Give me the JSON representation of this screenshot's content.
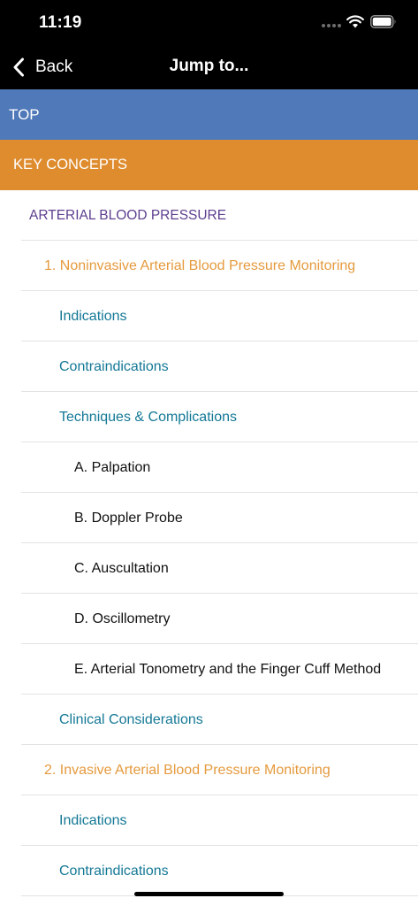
{
  "status": {
    "time": "11:19"
  },
  "nav": {
    "back_label": "Back",
    "title": "Jump to..."
  },
  "sections": {
    "top": "TOP",
    "key_concepts": "KEY CONCEPTS"
  },
  "toc": [
    {
      "label": "ARTERIAL BLOOD PRESSURE",
      "level": 0
    },
    {
      "label": "1. Noninvasive Arterial Blood Pressure Monitoring",
      "level": 1
    },
    {
      "label": "Indications",
      "level": 2
    },
    {
      "label": "Contraindications",
      "level": 2
    },
    {
      "label": "Techniques & Complications",
      "level": 2
    },
    {
      "label": "A. Palpation",
      "level": 3
    },
    {
      "label": "B. Doppler Probe",
      "level": 3
    },
    {
      "label": "C. Auscultation",
      "level": 3
    },
    {
      "label": "D. Oscillometry",
      "level": 3
    },
    {
      "label": "E. Arterial Tonometry and the Finger Cuff Method",
      "level": 3
    },
    {
      "label": "Clinical Considerations",
      "level": 2
    },
    {
      "label": "2. Invasive Arterial Blood Pressure Monitoring",
      "level": 1
    },
    {
      "label": "Indications",
      "level": 2
    },
    {
      "label": "Contraindications",
      "level": 2
    }
  ],
  "colors": {
    "top_bar": "#5079b9",
    "key_concepts_bar": "#de8c2e",
    "level_0": "#5d3f8f",
    "level_1": "#e59a3e",
    "level_2": "#147896",
    "level_3": "#111111"
  }
}
